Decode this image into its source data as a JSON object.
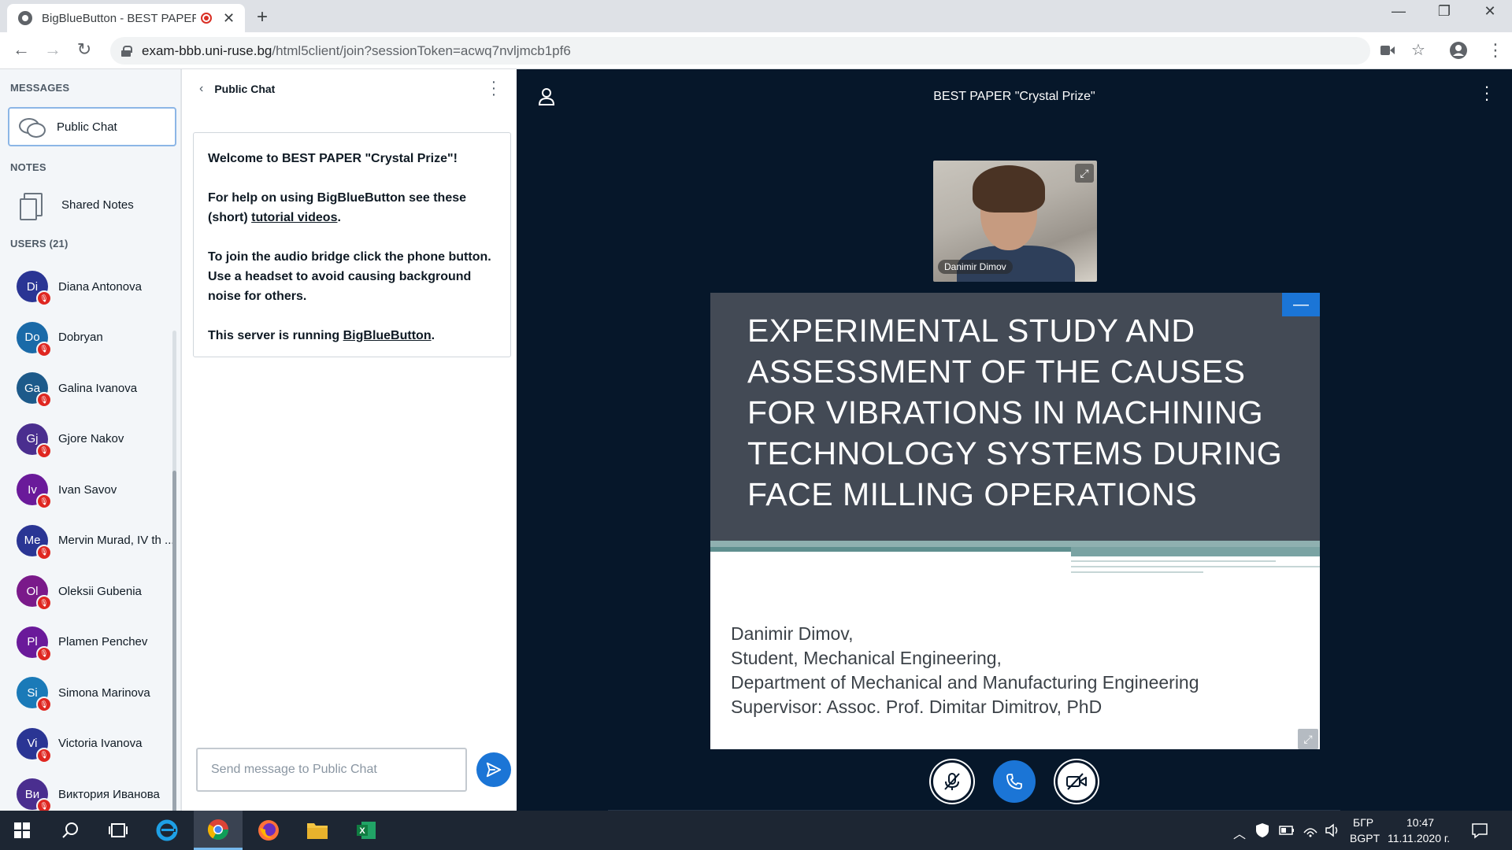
{
  "browser": {
    "tab_title": "BigBlueButton - BEST PAPER",
    "tab_close": "✕",
    "new_tab": "+",
    "url_host": "exam-bbb.uni-ruse.bg",
    "url_path": "/html5client/join?sessionToken=acwq7nvljmcb1pf6"
  },
  "left_panel": {
    "messages_title": "MESSAGES",
    "public_chat_label": "Public Chat",
    "notes_title": "NOTES",
    "shared_notes_label": "Shared Notes",
    "users_title": "USERS (21)",
    "users": [
      {
        "initials": "Di",
        "name": "Diana Antonova",
        "color": "#2a3594"
      },
      {
        "initials": "Do",
        "name": "Dobryan",
        "color": "#1a6aa8"
      },
      {
        "initials": "Ga",
        "name": "Galina Ivanova",
        "color": "#1d5a8a"
      },
      {
        "initials": "Gj",
        "name": "Gjore Nakov",
        "color": "#4a2e8f"
      },
      {
        "initials": "Iv",
        "name": "Ivan Savov",
        "color": "#6a1a9a"
      },
      {
        "initials": "Me",
        "name": "Mervin Murad, IV th ...",
        "color": "#2a3594"
      },
      {
        "initials": "Ol",
        "name": "Oleksii Gubenia",
        "color": "#7a1a8a"
      },
      {
        "initials": "Pl",
        "name": "Plamen Penchev",
        "color": "#6a1a9a"
      },
      {
        "initials": "Si",
        "name": "Simona Marinova",
        "color": "#1a7ab8"
      },
      {
        "initials": "Vi",
        "name": "Victoria Ivanova",
        "color": "#2a3594"
      },
      {
        "initials": "Ви",
        "name": "Виктория Иванова",
        "color": "#4a2e8f"
      }
    ]
  },
  "chat": {
    "header": "Public Chat",
    "welcome_line1_a": "Welcome to ",
    "welcome_line1_b": "BEST PAPER \"Crystal Prize\"",
    "welcome_line1_c": "!",
    "help_a": "For help on using BigBlueButton see these (short) ",
    "help_link": "tutorial videos",
    "help_c": ".",
    "audio_text": "To join the audio bridge click the phone button. Use a headset to avoid causing background noise for others.",
    "server_a": "This server is running ",
    "server_link": "BigBlueButton",
    "server_c": ".",
    "input_placeholder": "Send message to Public Chat"
  },
  "main": {
    "meeting_title": "BEST PAPER \"Crystal Prize\"",
    "webcam_name": "Danimir Dimov",
    "slide": {
      "title": "EXPERIMENTAL STUDY AND ASSESSMENT OF THE CAUSES FOR VIBRATIONS IN MACHINING TECHNOLOGY SYSTEMS DURING FACE MILLING OPERATIONS",
      "line1": "Danimir Dimov,",
      "line2": "Student, Mechanical Engineering,",
      "line3": "Department of Mechanical and Manufacturing Engineering",
      "line4": "Supervisor: Assoc. Prof. Dimitar Dimitrov, PhD"
    }
  },
  "taskbar": {
    "lang_top": "БГР",
    "lang_bottom": "BGPT",
    "time": "10:47",
    "date": "11.11.2020 г."
  },
  "colors": {
    "accent_blue": "#1b75d6",
    "mute_red": "#df2721",
    "main_bg": "#06172a"
  }
}
